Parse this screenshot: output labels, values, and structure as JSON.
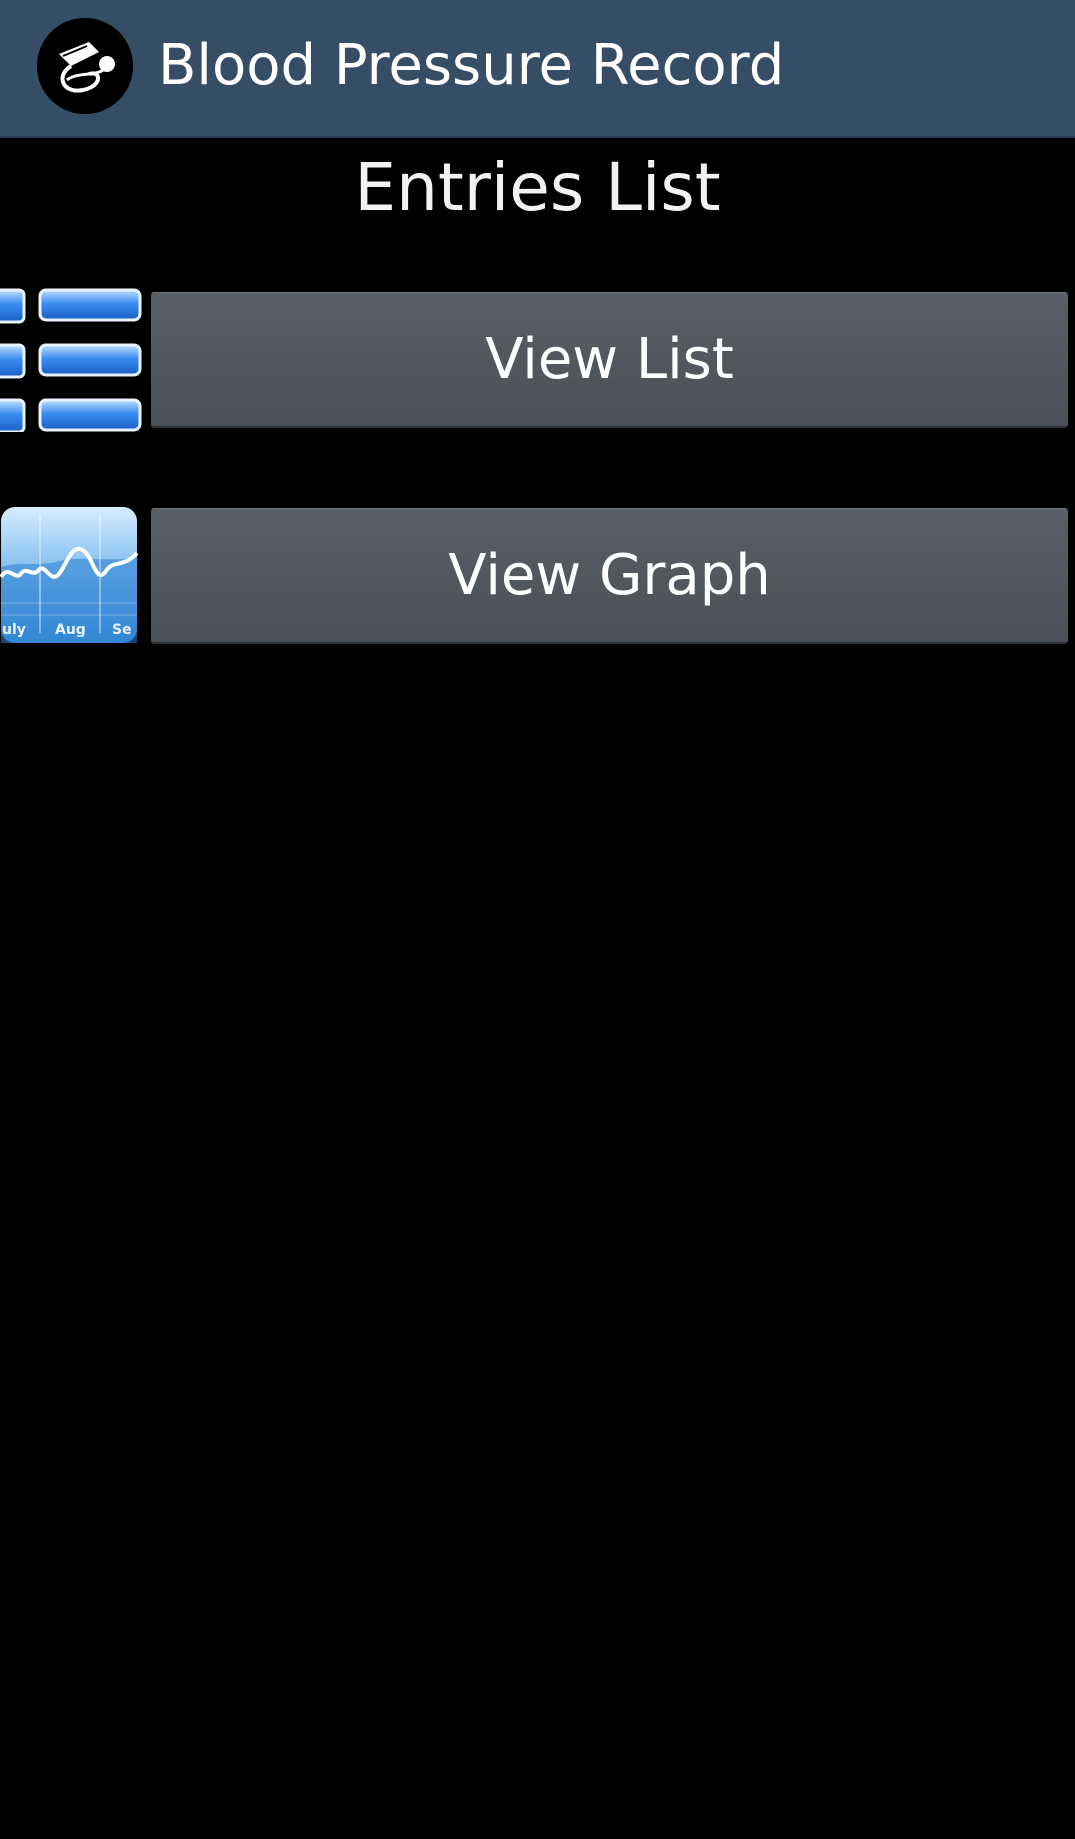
{
  "app": {
    "title": "Blood Pressure Record",
    "logo_icon": "blood-pressure-cuff-icon"
  },
  "page": {
    "title": "Entries List"
  },
  "actions": [
    {
      "label": "View List",
      "icon": "list-icon"
    },
    {
      "label": "View Graph",
      "icon": "graph-icon",
      "icon_labels": [
        "uly",
        "Aug",
        "Se"
      ]
    }
  ],
  "colors": {
    "action_bar": "#364d66",
    "background": "#000000",
    "button": "#53585f",
    "icon_blue": "#3a8cf0"
  }
}
